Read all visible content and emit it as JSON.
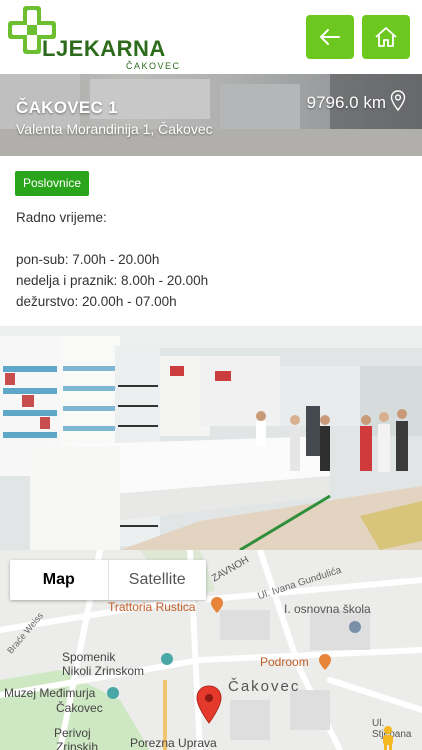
{
  "header": {
    "logo_title": "LJEKARNA",
    "logo_sub": "ČAKOVEC",
    "back_icon": "arrow-left-icon",
    "home_icon": "home-icon",
    "accent": "#6cc71f"
  },
  "store": {
    "name": "ČAKOVEC 1",
    "address": "Valenta Morandinija 1, Čakovec",
    "distance": "9796.0 km"
  },
  "info": {
    "badge": "Poslovnice",
    "hours_title": "Radno vrijeme:",
    "hours": [
      "pon-sub: 7.00h - 20.00h",
      "nedelja i praznik: 8.00h - 20.00h",
      "dežurstvo: 20.00h - 07.00h"
    ]
  },
  "map": {
    "tab_map": "Map",
    "tab_satellite": "Satellite",
    "labels": {
      "trattoria": "Trattoria Rustica",
      "ivana": "Ul. Ivana Gundulića",
      "zavnoh": "ZAVNOH",
      "skola": "I. osnovna škola",
      "brace": "Braće Weiss",
      "spomenik1": "Spomenik",
      "spomenik2": "Nikoli Zrinskom",
      "podroom": "Podroom",
      "muzej1": "Muzej Međimurja",
      "muzej2": "Čakovec",
      "cakovec": "Čakovec",
      "perivoj1": "Perivoj",
      "perivoj2": "Zrinskih",
      "porezna": "Porezna Uprava",
      "stjepana": "Ul. Stjepana"
    }
  }
}
